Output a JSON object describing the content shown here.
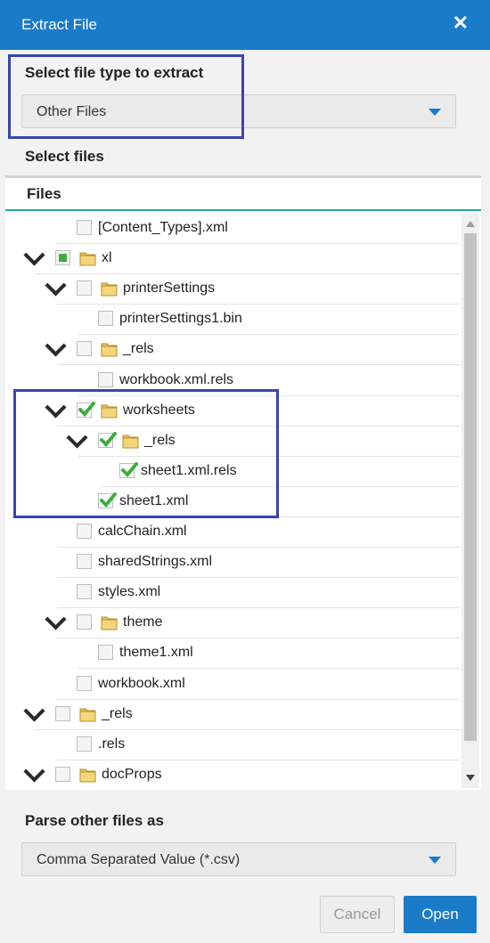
{
  "dialog": {
    "title": "Extract File"
  },
  "file_type": {
    "label": "Select file type to extract",
    "selected": "Other Files"
  },
  "select_files": {
    "label": "Select files"
  },
  "files_panel": {
    "header": "Files"
  },
  "tree": [
    {
      "label": "[Content_Types].xml",
      "state": "unchecked",
      "type": "file",
      "level": 1,
      "expanded": false
    },
    {
      "label": "xl",
      "state": "partial",
      "type": "folder",
      "level": 0,
      "expanded": true
    },
    {
      "label": "printerSettings",
      "state": "unchecked",
      "type": "folder",
      "level": 1,
      "expanded": true
    },
    {
      "label": "printerSettings1.bin",
      "state": "unchecked",
      "type": "file",
      "level": 2,
      "expanded": false
    },
    {
      "label": "_rels",
      "state": "unchecked",
      "type": "folder",
      "level": 1,
      "expanded": true
    },
    {
      "label": "workbook.xml.rels",
      "state": "unchecked",
      "type": "file",
      "level": 2,
      "expanded": false
    },
    {
      "label": "worksheets",
      "state": "checked",
      "type": "folder",
      "level": 1,
      "expanded": true
    },
    {
      "label": "_rels",
      "state": "checked",
      "type": "folder",
      "level": 2,
      "expanded": true
    },
    {
      "label": "sheet1.xml.rels",
      "state": "checked",
      "type": "file",
      "level": 3,
      "expanded": false
    },
    {
      "label": "sheet1.xml",
      "state": "checked",
      "type": "file",
      "level": 2,
      "expanded": false
    },
    {
      "label": "calcChain.xml",
      "state": "unchecked",
      "type": "file",
      "level": 1,
      "expanded": false
    },
    {
      "label": "sharedStrings.xml",
      "state": "unchecked",
      "type": "file",
      "level": 1,
      "expanded": false
    },
    {
      "label": "styles.xml",
      "state": "unchecked",
      "type": "file",
      "level": 1,
      "expanded": false
    },
    {
      "label": "theme",
      "state": "unchecked",
      "type": "folder",
      "level": 1,
      "expanded": true
    },
    {
      "label": "theme1.xml",
      "state": "unchecked",
      "type": "file",
      "level": 2,
      "expanded": false
    },
    {
      "label": "workbook.xml",
      "state": "unchecked",
      "type": "file",
      "level": 1,
      "expanded": false
    },
    {
      "label": "_rels",
      "state": "unchecked",
      "type": "folder",
      "level": 0,
      "expanded": true
    },
    {
      "label": ".rels",
      "state": "unchecked",
      "type": "file",
      "level": 1,
      "expanded": false
    },
    {
      "label": "docProps",
      "state": "unchecked",
      "type": "folder",
      "level": 0,
      "expanded": true
    }
  ],
  "parse": {
    "label": "Parse other files as",
    "selected": "Comma Separated Value (*.csv)"
  },
  "buttons": {
    "cancel": "Cancel",
    "open": "Open"
  },
  "colors": {
    "accent": "#1a7bc9",
    "highlight": "#3a44b0",
    "check": "#3dae3d",
    "divider": "#27a595"
  }
}
